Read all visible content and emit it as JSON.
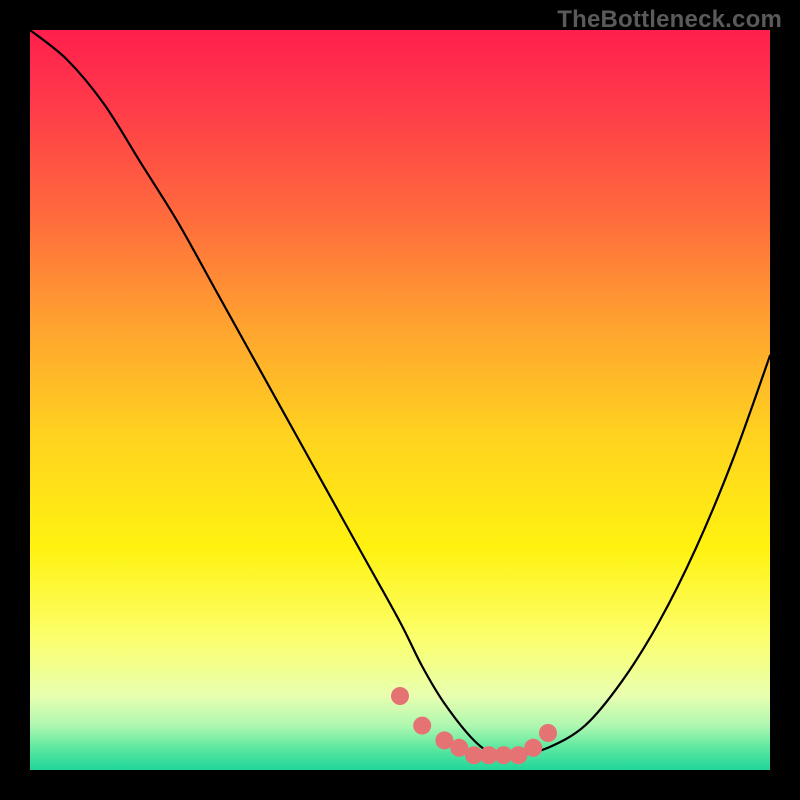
{
  "watermark": "TheBottleneck.com",
  "chart_data": {
    "type": "line",
    "title": "",
    "xlabel": "",
    "ylabel": "",
    "xlim": [
      0,
      100
    ],
    "ylim": [
      0,
      100
    ],
    "grid": false,
    "legend": false,
    "background_gradient": {
      "stops": [
        {
          "pos": 0.0,
          "color": "#ff1f4d"
        },
        {
          "pos": 0.1,
          "color": "#ff3a4a"
        },
        {
          "pos": 0.25,
          "color": "#ff6a3d"
        },
        {
          "pos": 0.4,
          "color": "#ffa32f"
        },
        {
          "pos": 0.55,
          "color": "#ffd31f"
        },
        {
          "pos": 0.7,
          "color": "#fff210"
        },
        {
          "pos": 0.82,
          "color": "#fcff6b"
        },
        {
          "pos": 0.9,
          "color": "#e8ffb0"
        },
        {
          "pos": 0.94,
          "color": "#aef7b0"
        },
        {
          "pos": 0.97,
          "color": "#5de8a0"
        },
        {
          "pos": 1.0,
          "color": "#1fd69a"
        }
      ]
    },
    "series": [
      {
        "name": "bottleneck-curve",
        "color": "#000000",
        "x": [
          0,
          5,
          10,
          15,
          20,
          25,
          30,
          35,
          40,
          45,
          50,
          53,
          56,
          60,
          63,
          66,
          70,
          75,
          80,
          85,
          90,
          95,
          100
        ],
        "values": [
          100,
          96,
          90,
          82,
          74,
          65,
          56,
          47,
          38,
          29,
          20,
          14,
          9,
          4,
          2,
          2,
          3,
          6,
          12,
          20,
          30,
          42,
          56
        ]
      }
    ],
    "markers": {
      "name": "highlight-dots",
      "color": "#e57373",
      "radius": 9,
      "x": [
        50,
        53,
        56,
        58,
        60,
        62,
        64,
        66,
        68,
        70
      ],
      "values": [
        10,
        6,
        4,
        3,
        2,
        2,
        2,
        2,
        3,
        5
      ]
    }
  }
}
